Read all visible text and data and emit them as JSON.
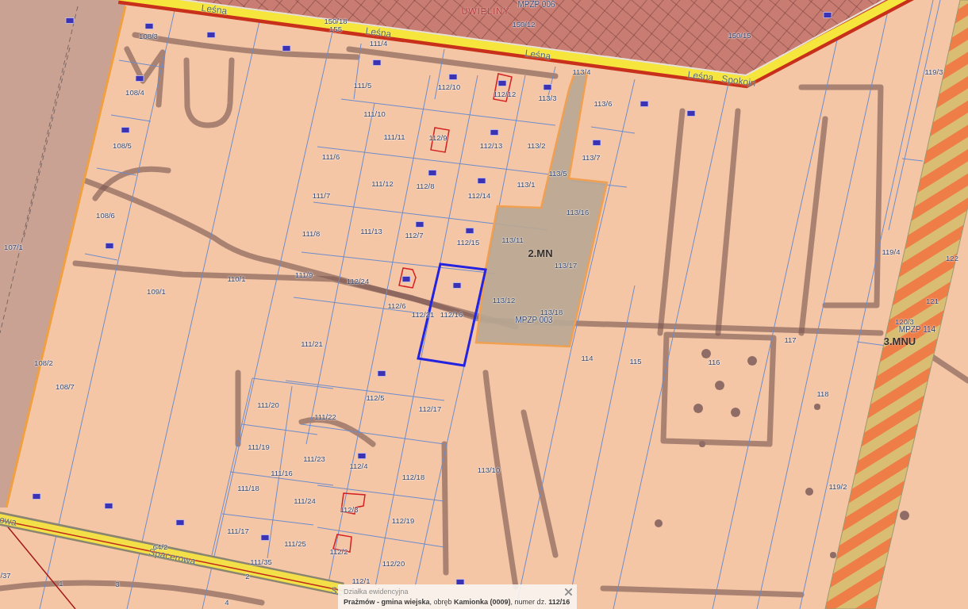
{
  "map": {
    "places": [
      "UWIELINY"
    ],
    "streets": [
      "Leśna",
      "Leśna",
      "Leśna",
      "Leśna",
      "Spokojn",
      "owa",
      "Spacerowa",
      "S"
    ],
    "zoning": [
      {
        "text": "MPZP 006",
        "kind": "plan"
      },
      {
        "text": "2.MN",
        "kind": "zone"
      },
      {
        "text": "MPZP 003",
        "kind": "plan"
      },
      {
        "text": "MPZP 114",
        "kind": "plan"
      },
      {
        "text": "3.MNU",
        "kind": "zone"
      }
    ],
    "parcels": [
      "150/18",
      "108/3",
      "155",
      "150/12",
      "111/4",
      "150/15",
      "113/4",
      "119/3",
      "108/4",
      "111/5",
      "112/10",
      "112/12",
      "113/3",
      "113/6",
      "111/10",
      "108/5",
      "111/11",
      "112/9",
      "112/13",
      "113/2",
      "111/6",
      "113/7",
      "113/5",
      "111/12",
      "112/8",
      "113/1",
      "111/7",
      "112/14",
      "108/6",
      "113/16",
      "107/1",
      "111/8",
      "111/13",
      "112/7",
      "112/15",
      "113/11",
      "119/4",
      "113/17",
      "122",
      "110/1",
      "111/9",
      "112/24",
      "109/1",
      "112/6",
      "113/12",
      "121",
      "112/21",
      "112/16",
      "113/18",
      "120/3",
      "111/21",
      "117",
      "108/2",
      "114",
      "115",
      "116",
      "108/7",
      "111/20",
      "112/5",
      "118",
      "111/22",
      "112/17",
      "111/19",
      "111/23",
      "111/16",
      "112/4",
      "112/18",
      "113/10",
      "111/18",
      "119/2",
      "111/24",
      "112/3",
      "112/19",
      "111/17",
      "64/2",
      "111/25",
      "112/2",
      "111/35",
      "112/20",
      "/37",
      "1",
      "3",
      "2",
      "112/1",
      "4"
    ]
  },
  "popup": {
    "title": "Działka ewidencyjna",
    "text": "**Prażmów - gmina wiejska**, obręb **Kamionka (0009)**, numer dz. **112/16**"
  }
}
